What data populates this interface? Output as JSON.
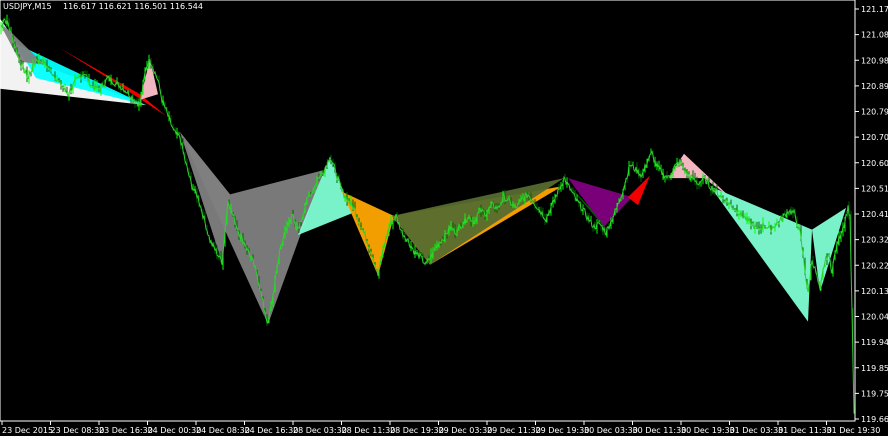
{
  "header": {
    "symbol": "USDJPY,M15",
    "ohlc": "116.617 116.621 116.501 116.544"
  },
  "colors": {
    "background": "#000000",
    "axis": "#ffffff",
    "bull_candle": "#00ff00",
    "bear_candle": "#006400"
  },
  "chart_data": {
    "type": "line",
    "y_ticks": [
      "121.175",
      "121.080",
      "120.985",
      "120.890",
      "120.795",
      "120.700",
      "120.605",
      "120.510",
      "120.415",
      "120.320",
      "120.225",
      "120.135",
      "120.040",
      "119.945",
      "119.850",
      "119.755",
      "119.660"
    ],
    "x_ticks": [
      "23 Dec 2015",
      "23 Dec 08:30",
      "23 Dec 16:30",
      "24 Dec 00:30",
      "24 Dec 08:30",
      "24 Dec 16:30",
      "28 Dec 03:30",
      "28 Dec 11:30",
      "28 Dec 19:30",
      "29 Dec 03:30",
      "29 Dec 11:30",
      "29 Dec 19:30",
      "30 Dec 03:30",
      "30 Dec 11:30",
      "30 Dec 19:30",
      "31 Dec 03:30",
      "31 Dec 11:30",
      "31 Dec 19:30"
    ],
    "ylim": [
      119.66,
      121.175
    ],
    "grid": false,
    "price_path": [
      [
        0,
        121.1
      ],
      [
        4,
        121.14
      ],
      [
        8,
        121.12
      ],
      [
        14,
        121.05
      ],
      [
        20,
        120.98
      ],
      [
        28,
        120.92
      ],
      [
        36,
        120.99
      ],
      [
        44,
        120.98
      ],
      [
        52,
        120.94
      ],
      [
        60,
        120.9
      ],
      [
        68,
        120.86
      ],
      [
        76,
        120.91
      ],
      [
        84,
        120.94
      ],
      [
        92,
        120.89
      ],
      [
        100,
        120.88
      ],
      [
        108,
        120.92
      ],
      [
        116,
        120.9
      ],
      [
        124,
        120.88
      ],
      [
        132,
        120.85
      ],
      [
        140,
        120.82
      ],
      [
        146,
        120.96
      ],
      [
        150,
        120.99
      ],
      [
        154,
        120.95
      ],
      [
        158,
        120.91
      ],
      [
        162,
        120.84
      ],
      [
        168,
        120.78
      ],
      [
        174,
        120.72
      ],
      [
        180,
        120.7
      ],
      [
        186,
        120.6
      ],
      [
        192,
        120.52
      ],
      [
        198,
        120.48
      ],
      [
        204,
        120.4
      ],
      [
        210,
        120.32
      ],
      [
        216,
        120.28
      ],
      [
        222,
        120.24
      ],
      [
        228,
        120.47
      ],
      [
        234,
        120.4
      ],
      [
        240,
        120.34
      ],
      [
        246,
        120.3
      ],
      [
        252,
        120.25
      ],
      [
        258,
        120.18
      ],
      [
        264,
        120.07
      ],
      [
        268,
        120.01
      ],
      [
        274,
        120.14
      ],
      [
        280,
        120.29
      ],
      [
        286,
        120.36
      ],
      [
        292,
        120.42
      ],
      [
        296,
        120.36
      ],
      [
        300,
        120.38
      ],
      [
        306,
        120.46
      ],
      [
        312,
        120.5
      ],
      [
        318,
        120.55
      ],
      [
        324,
        120.58
      ],
      [
        330,
        120.63
      ],
      [
        336,
        120.57
      ],
      [
        342,
        120.5
      ],
      [
        348,
        120.47
      ],
      [
        354,
        120.44
      ],
      [
        360,
        120.38
      ],
      [
        366,
        120.33
      ],
      [
        372,
        120.27
      ],
      [
        378,
        120.19
      ],
      [
        384,
        120.3
      ],
      [
        390,
        120.38
      ],
      [
        396,
        120.41
      ],
      [
        402,
        120.35
      ],
      [
        408,
        120.32
      ],
      [
        414,
        120.28
      ],
      [
        420,
        120.26
      ],
      [
        426,
        120.23
      ],
      [
        432,
        120.27
      ],
      [
        438,
        120.31
      ],
      [
        444,
        120.33
      ],
      [
        450,
        120.37
      ],
      [
        456,
        120.35
      ],
      [
        462,
        120.38
      ],
      [
        468,
        120.41
      ],
      [
        474,
        120.39
      ],
      [
        480,
        120.43
      ],
      [
        486,
        120.42
      ],
      [
        492,
        120.45
      ],
      [
        498,
        120.44
      ],
      [
        504,
        120.48
      ],
      [
        510,
        120.46
      ],
      [
        516,
        120.44
      ],
      [
        522,
        120.47
      ],
      [
        528,
        120.49
      ],
      [
        534,
        120.46
      ],
      [
        540,
        120.43
      ],
      [
        546,
        120.4
      ],
      [
        552,
        120.45
      ],
      [
        558,
        120.5
      ],
      [
        564,
        120.55
      ],
      [
        570,
        120.51
      ],
      [
        576,
        120.47
      ],
      [
        582,
        120.44
      ],
      [
        588,
        120.4
      ],
      [
        594,
        120.37
      ],
      [
        600,
        120.38
      ],
      [
        606,
        120.35
      ],
      [
        612,
        120.4
      ],
      [
        618,
        120.45
      ],
      [
        624,
        120.52
      ],
      [
        630,
        120.6
      ],
      [
        636,
        120.58
      ],
      [
        642,
        120.56
      ],
      [
        648,
        120.62
      ],
      [
        652,
        120.64
      ],
      [
        656,
        120.6
      ],
      [
        662,
        120.57
      ],
      [
        668,
        120.55
      ],
      [
        674,
        120.59
      ],
      [
        680,
        120.61
      ],
      [
        686,
        120.57
      ],
      [
        692,
        120.55
      ],
      [
        698,
        120.53
      ],
      [
        704,
        120.55
      ],
      [
        710,
        120.52
      ],
      [
        716,
        120.5
      ],
      [
        722,
        120.48
      ],
      [
        728,
        120.46
      ],
      [
        734,
        120.44
      ],
      [
        740,
        120.42
      ],
      [
        746,
        120.4
      ],
      [
        752,
        120.38
      ],
      [
        758,
        120.36
      ],
      [
        764,
        120.38
      ],
      [
        770,
        120.36
      ],
      [
        776,
        120.38
      ],
      [
        782,
        120.4
      ],
      [
        788,
        120.43
      ],
      [
        794,
        120.42
      ],
      [
        800,
        120.35
      ],
      [
        804,
        120.24
      ],
      [
        808,
        120.12
      ],
      [
        812,
        120.25
      ],
      [
        816,
        120.2
      ],
      [
        820,
        120.13
      ],
      [
        824,
        120.23
      ],
      [
        828,
        120.27
      ],
      [
        832,
        120.21
      ],
      [
        836,
        120.29
      ],
      [
        840,
        120.34
      ],
      [
        844,
        120.38
      ],
      [
        848,
        120.44
      ],
      [
        850,
        120.41
      ],
      [
        852,
        120.05
      ],
      [
        854,
        119.68
      ]
    ],
    "pattern_colors": [
      "#ffffff",
      "#00ffff",
      "#808080",
      "#ff0000",
      "#ffc0cb",
      "#ffa500",
      "#800080",
      "#7fffd4",
      "#556b2f",
      "#006400"
    ]
  }
}
